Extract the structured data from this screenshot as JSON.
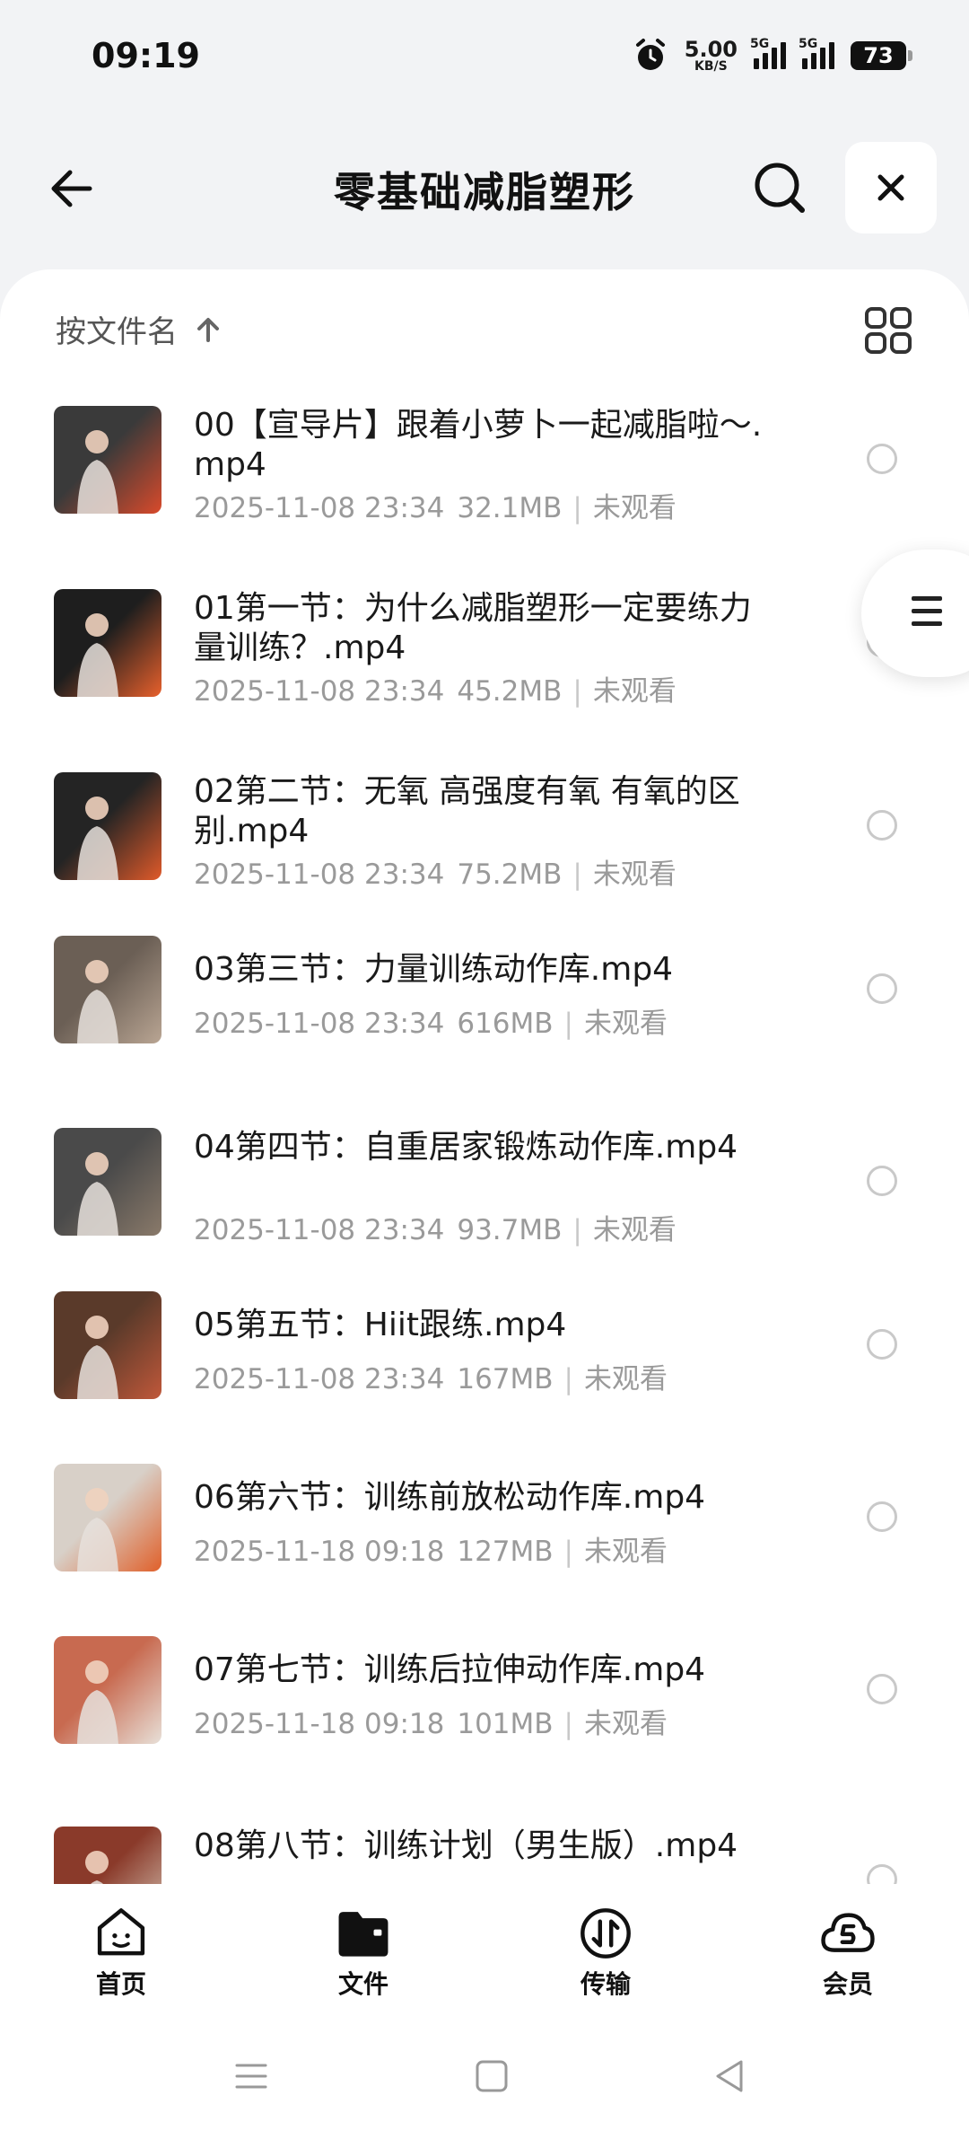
{
  "status_bar": {
    "time": "09:19",
    "speed_value": "5.00",
    "speed_unit": "KB/S",
    "signal1_tag": "5G",
    "signal2_tag": "5G",
    "battery": "73"
  },
  "header": {
    "title": "零基础减脂塑形"
  },
  "sort": {
    "label": "按文件名"
  },
  "files": [
    {
      "name": "00【宣导片】跟着小萝卜一起减脂啦～.mp4",
      "date": "2025-11-08 23:34",
      "size": "32.1MB",
      "status": "未观看",
      "thumb_colors": [
        "#3a3a3a",
        "#d94a2b"
      ]
    },
    {
      "name": "01第一节：为什么减脂塑形一定要练力量训练？.mp4",
      "date": "2025-11-08 23:34",
      "size": "45.2MB",
      "status": "未观看",
      "thumb_colors": [
        "#1e1e1e",
        "#e8602c"
      ]
    },
    {
      "name": "02第二节：无氧 高强度有氧 有氧的区别.mp4",
      "date": "2025-11-08 23:34",
      "size": "75.2MB",
      "status": "未观看",
      "thumb_colors": [
        "#242424",
        "#e05a2a"
      ]
    },
    {
      "name": "03第三节：力量训练动作库.mp4",
      "date": "2025-11-08 23:34",
      "size": "616MB",
      "status": "未观看",
      "thumb_colors": [
        "#6b5f55",
        "#b9a593"
      ]
    },
    {
      "name": "04第四节：自重居家锻炼动作库.mp4",
      "date": "2025-11-08 23:34",
      "size": "93.7MB",
      "status": "未观看",
      "thumb_colors": [
        "#4a4a4a",
        "#8a7a6a"
      ]
    },
    {
      "name": "05第五节：Hiit跟练.mp4",
      "date": "2025-11-08 23:34",
      "size": "167MB",
      "status": "未观看",
      "thumb_colors": [
        "#5a3a2a",
        "#c0583a"
      ]
    },
    {
      "name": "06第六节：训练前放松动作库.mp4",
      "date": "2025-11-18 09:18",
      "size": "127MB",
      "status": "未观看",
      "thumb_colors": [
        "#d8d0c8",
        "#e0602a"
      ]
    },
    {
      "name": "07第七节：训练后拉伸动作库.mp4",
      "date": "2025-11-18 09:18",
      "size": "101MB",
      "status": "未观看",
      "thumb_colors": [
        "#c86a50",
        "#e8e0d8"
      ]
    },
    {
      "name": "08第八节：训练计划（男生版）.mp4",
      "date": "",
      "size": "",
      "status": "",
      "thumb_colors": [
        "#8a3a2a",
        "#d8c8b8"
      ]
    }
  ],
  "nav": {
    "home": "首页",
    "files": "文件",
    "transfer": "传输",
    "member": "会员"
  }
}
